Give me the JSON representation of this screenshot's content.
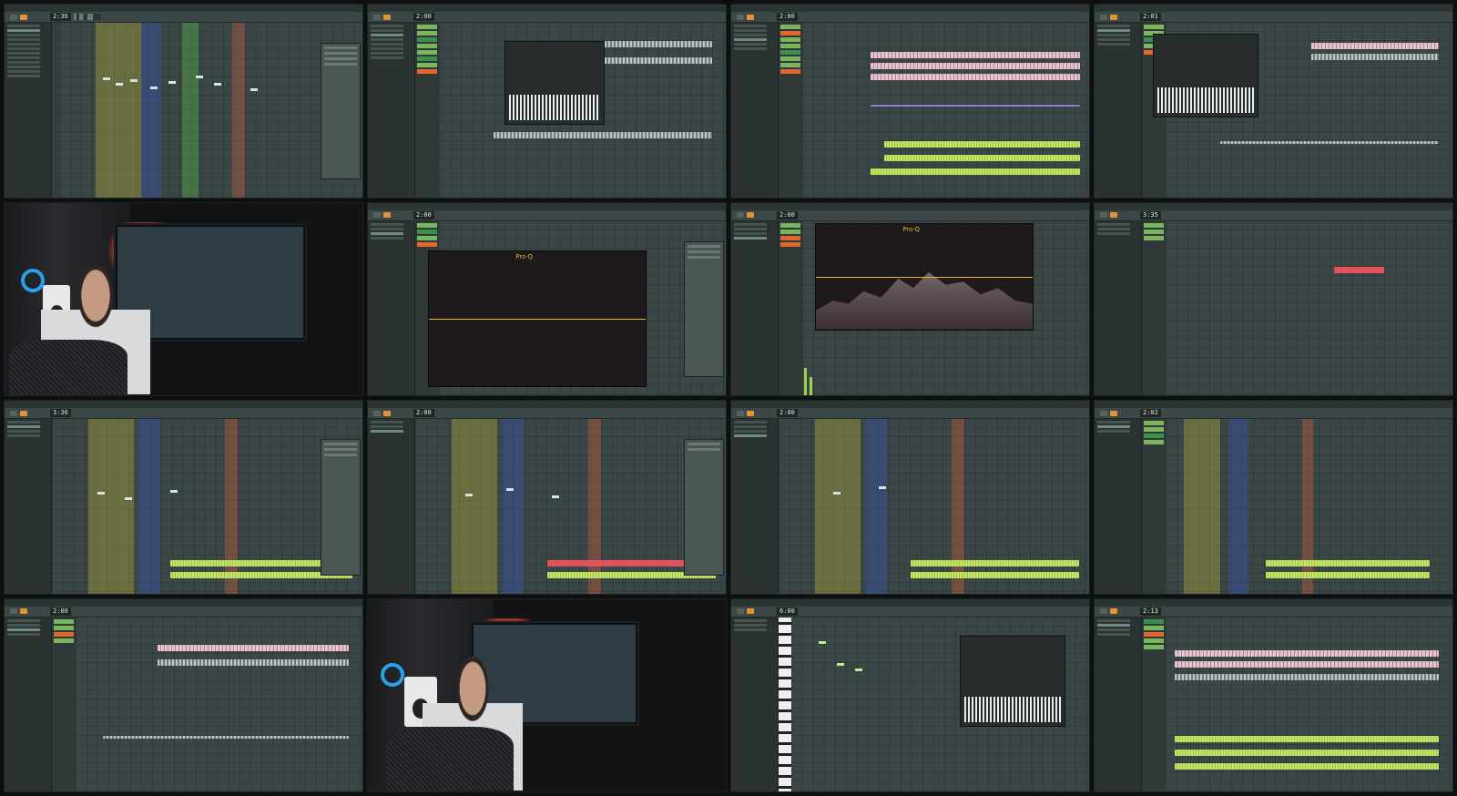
{
  "tiles": [
    {
      "kind": "daw",
      "time": "2:36"
    },
    {
      "kind": "daw",
      "time": "2:00"
    },
    {
      "kind": "daw",
      "time": "2:00"
    },
    {
      "kind": "daw",
      "time": "2:01"
    },
    {
      "kind": "photo"
    },
    {
      "kind": "daw",
      "time": "2:00"
    },
    {
      "kind": "daw",
      "time": "2:00"
    },
    {
      "kind": "daw",
      "time": "3:35"
    },
    {
      "kind": "daw",
      "time": "3:36"
    },
    {
      "kind": "daw",
      "time": "2:00"
    },
    {
      "kind": "daw",
      "time": "2:00"
    },
    {
      "kind": "daw",
      "time": "2:02"
    },
    {
      "kind": "daw",
      "time": "2:00"
    },
    {
      "kind": "photo"
    },
    {
      "kind": "daw",
      "time": "6:00"
    },
    {
      "kind": "daw",
      "time": "2:13"
    }
  ],
  "plugin_labels": {
    "eq": "Pro·Q"
  },
  "colors": {
    "accent": "#e09532",
    "clip_green": "#c6e56b",
    "clip_pink": "#e8c3cc",
    "brand_blue": "#2aa0e8"
  }
}
